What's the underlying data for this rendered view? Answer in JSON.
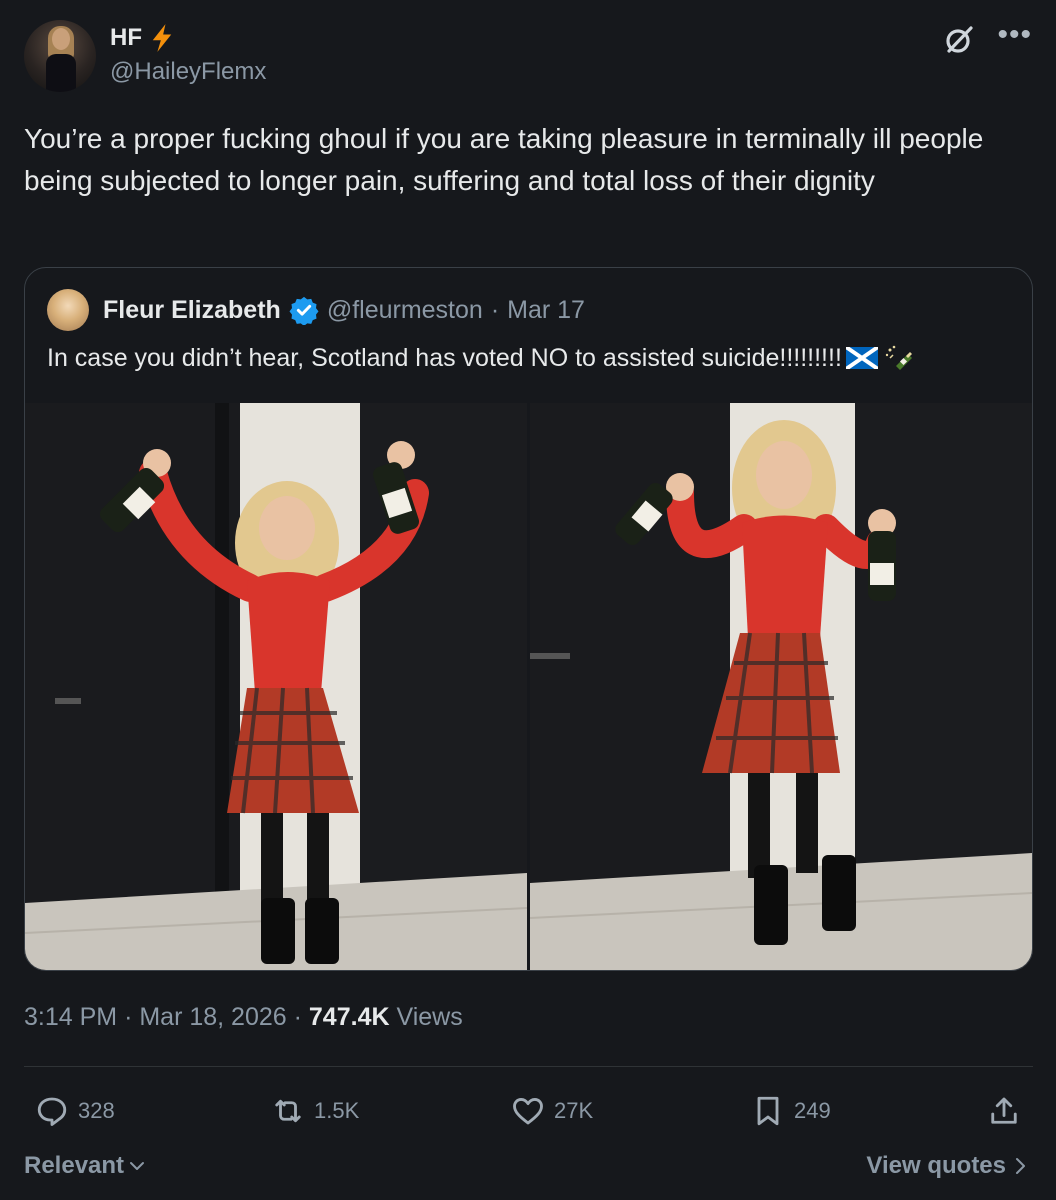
{
  "tweet": {
    "author": {
      "display_name": "HF",
      "name_badge_icon": "lightning-bolt-icon",
      "handle": "@HaileyFlemx"
    },
    "top_icons": [
      "grok-icon",
      "more-icon"
    ],
    "text": "You’re a proper fucking ghoul if you are taking pleasure in terminally ill people being subjected to longer pain, suffering and total loss of their dignity",
    "quoted": {
      "display_name": "Fleur Elizabeth",
      "verified": true,
      "handle": "@fleurmeston",
      "separator": "·",
      "date": "Mar 17",
      "text": "In case you didn’t hear, Scotland has voted NO to assisted suicide!!!!!!!!!",
      "emojis": [
        "scotland-flag-icon",
        "champagne-bottle-icon"
      ]
    },
    "meta": {
      "time": "3:14 PM",
      "sep1": "·",
      "date": "Mar 18, 2026",
      "sep2": "·",
      "views_count": "747.4K",
      "views_label": "Views"
    },
    "actions": {
      "replies": "328",
      "reposts": "1.5K",
      "likes": "27K",
      "bookmarks": "249"
    },
    "footer": {
      "sort_label": "Relevant",
      "quotes_label": "View quotes"
    }
  },
  "colors": {
    "background": "#16181c",
    "text_primary": "#e7e9ea",
    "text_secondary": "#8b98a5",
    "verified_blue": "#1d9bf0",
    "bolt_orange": "#f4900c"
  }
}
